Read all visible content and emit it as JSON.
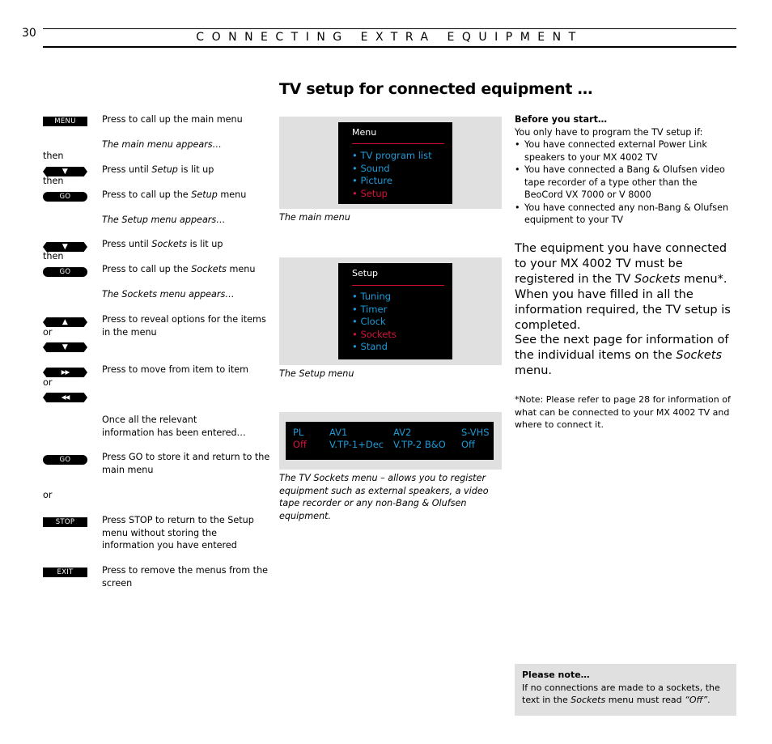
{
  "header": {
    "page_number": "30",
    "section_title": "CONNECTING EXTRA EQUIPMENT"
  },
  "main_title": "TV setup for connected equipment …",
  "steps": [
    {
      "button": "MENU",
      "text": "Press to call up the main menu"
    },
    {
      "note": "The main menu appears…"
    },
    {
      "connector": "then"
    },
    {
      "button": "▼",
      "text_pre": "Press until ",
      "text_em": "Setup",
      "text_post": " is lit up"
    },
    {
      "connector": "then"
    },
    {
      "button": "GO",
      "text_pre": "Press to call up the ",
      "text_em": "Setup",
      "text_post": " menu"
    },
    {
      "note": "The Setup menu appears…"
    },
    {
      "button": "▼",
      "text_pre": "Press until ",
      "text_em": "Sockets",
      "text_post": " is lit up"
    },
    {
      "connector": "then"
    },
    {
      "button": "GO",
      "text_pre": "Press to call up the ",
      "text_em": "Sockets",
      "text_post": " menu"
    },
    {
      "note": "The Sockets menu appears…"
    },
    {
      "button": "▲",
      "text": "Press to reveal options for the items in the menu"
    },
    {
      "connector": "or"
    },
    {
      "button": "▼"
    },
    {
      "button": "▶▶",
      "text": "Press to move from item to item"
    },
    {
      "connector": "or"
    },
    {
      "button": "◀◀"
    },
    {
      "text": "Once all the relevant information has been entered…"
    },
    {
      "button": "GO",
      "text": "Press GO to store it and return to the main menu"
    },
    {
      "connector": "or"
    },
    {
      "button": "STOP",
      "text": "Press STOP to return to the Setup menu without storing the information you have entered"
    },
    {
      "button": "EXIT",
      "text": "Press to remove the menus from the screen"
    }
  ],
  "main_menu_screen": {
    "title": "Menu",
    "items": [
      {
        "label": "• TV program list",
        "active": false
      },
      {
        "label": "• Sound",
        "active": false
      },
      {
        "label": "• Picture",
        "active": false
      },
      {
        "label": "• Setup",
        "active": true
      }
    ],
    "caption": "The main menu"
  },
  "setup_menu_screen": {
    "title": "Setup",
    "items": [
      {
        "label": "• Tuning",
        "active": false
      },
      {
        "label": "• Timer",
        "active": false
      },
      {
        "label": "• Clock",
        "active": false
      },
      {
        "label": "• Sockets",
        "active": true
      },
      {
        "label": "• Stand",
        "active": false
      }
    ],
    "caption": "The Setup menu"
  },
  "sockets_screen": {
    "columns": [
      {
        "heading": "PL",
        "value": "Off",
        "value_color": "#d4143c"
      },
      {
        "heading": "AV1",
        "value": "V.TP-1+Dec",
        "value_color": "#1e9ad6"
      },
      {
        "heading": "AV2",
        "value": "V.TP-2 B&O",
        "value_color": "#1e9ad6"
      },
      {
        "heading": "S-VHS",
        "value": "Off",
        "value_color": "#1e9ad6"
      }
    ],
    "caption": "The TV Sockets menu – allows you to register equipment such as external speakers, a video tape recorder or any non-Bang & Olufsen equipment."
  },
  "before_you_start": {
    "heading": "Before you start…",
    "intro": "You only have to program the TV setup if:",
    "bullets": [
      "You have connected external Power Link speakers to your MX 4002 TV",
      "You have connected a Bang & Olufsen video tape recorder of a type other than the BeoCord VX 7000 or V 8000",
      "You have connected any non-Bang & Olufsen equipment to your TV"
    ]
  },
  "body_paragraph_1": {
    "pre": "The equipment you have connected to your MX 4002 TV must be registered in the TV ",
    "em": "Sockets",
    "post": " menu*. When you have filled in all the information required, the TV setup is completed."
  },
  "body_paragraph_2": {
    "pre": "See the next page for information of the individual items on the ",
    "em": "Sockets",
    "post": " menu."
  },
  "footnote": "*Note: Please refer to page 28 for information of what can be connected to your MX 4002 TV and where to connect it.",
  "please_note": {
    "heading": "Please note…",
    "pre": "If no connections are made to a sockets, the text in the ",
    "em": "Sockets",
    "mid": " menu must read ",
    "em2": "“Off”",
    "post": "."
  },
  "colors": {
    "menu_item": "#1e9ad6",
    "menu_item_active": "#d4143c",
    "screen_frame": "#e0e0e0",
    "screen_bg": "#000000"
  }
}
